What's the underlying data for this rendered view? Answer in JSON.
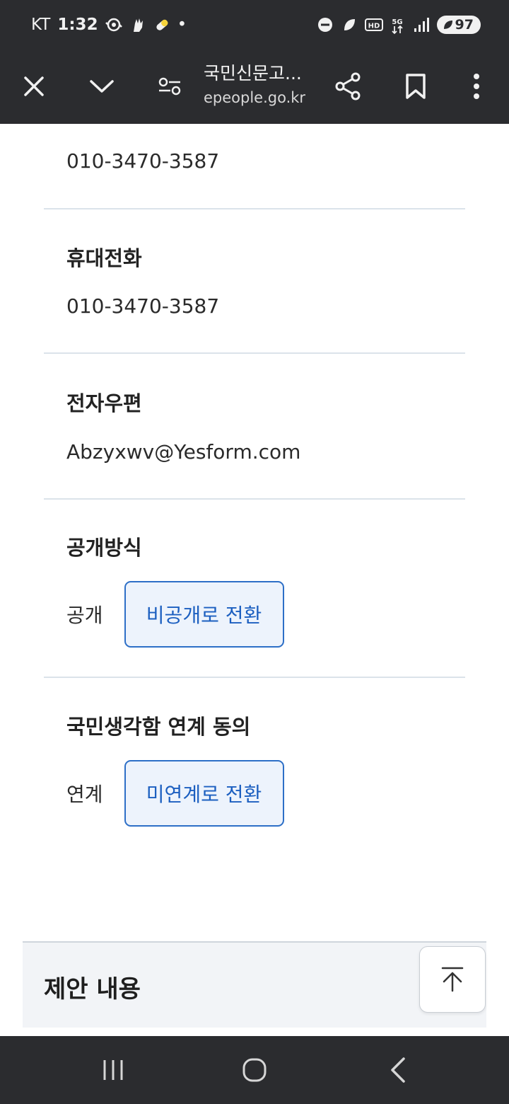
{
  "status_bar": {
    "carrier": "KT",
    "time": "1:32",
    "dot": "•",
    "battery_level": "97",
    "left_icons": [
      "sync-icon",
      "hand-icon",
      "pill-icon"
    ],
    "right_icons": [
      "do-not-disturb-icon",
      "leaf-icon",
      "hd-icon",
      "5g-icon",
      "signal-icon"
    ]
  },
  "toolbar": {
    "page_title": "국민신문고...",
    "url": "epeople.go.kr",
    "icons": [
      "close-icon",
      "chevron-down-icon",
      "page-info-icon",
      "share-icon",
      "bookmark-icon",
      "more-vert-icon"
    ]
  },
  "fields": {
    "phone_value": "010-3470-3587",
    "mobile_label": "휴대전화",
    "mobile_value": "010-3470-3587",
    "email_label": "전자우편",
    "email_value": "Abzyxwv@Yesform.com",
    "disclosure_label": "공개방식",
    "disclosure_value": "공개",
    "disclosure_button": "비공개로 전환",
    "link_label": "국민생각함 연계 동의",
    "link_value": "연계",
    "link_button": "미연계로 전환"
  },
  "section": {
    "title": "제안 내용"
  },
  "colors": {
    "accent": "#1c5fc0",
    "button_bg": "#edf3fc",
    "chrome": "#2b2c2f"
  }
}
